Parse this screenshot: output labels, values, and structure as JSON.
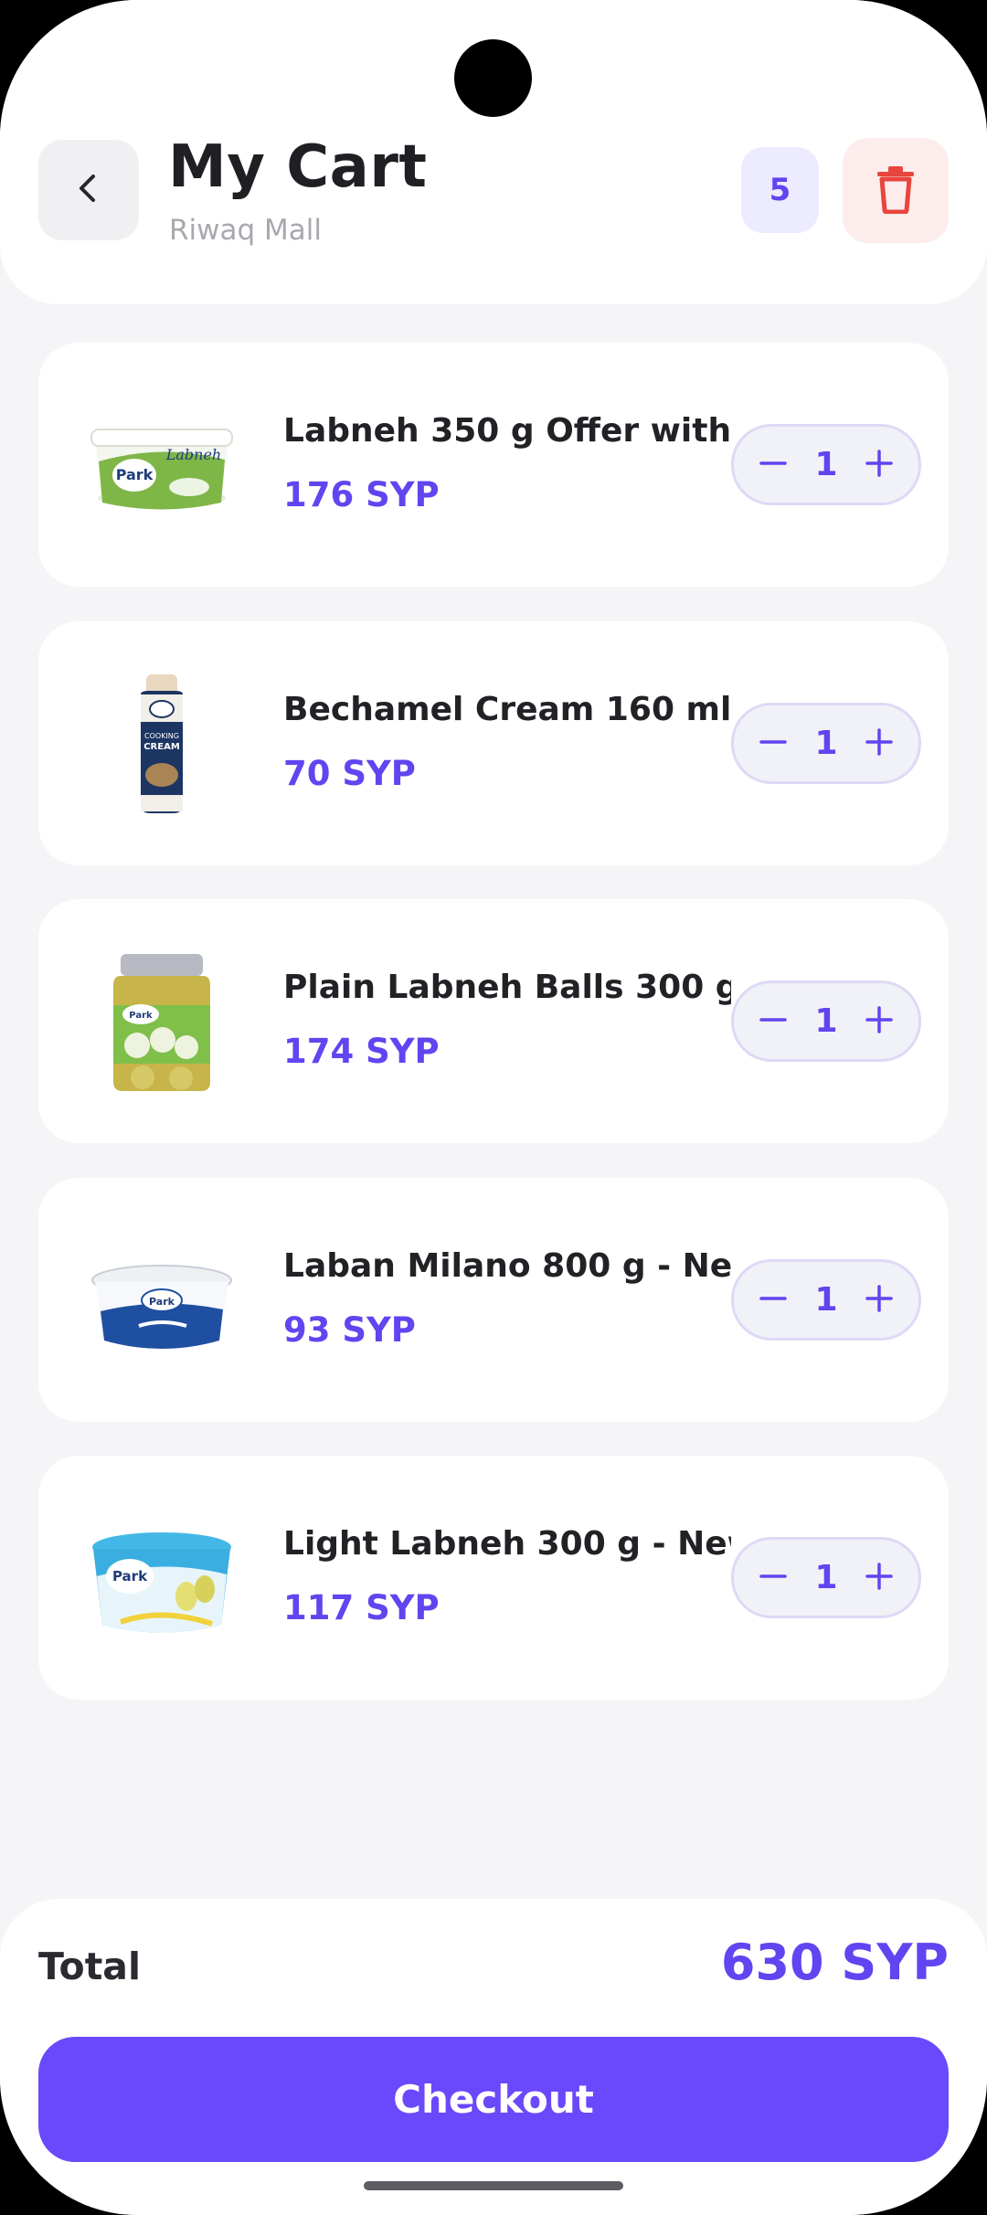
{
  "header": {
    "title": "My Cart",
    "subtitle": "Riwaq Mall",
    "item_count": "5"
  },
  "colors": {
    "accent": "#6a48fb",
    "price": "#6244f0",
    "danger": "#e8453c"
  },
  "cart": {
    "items": [
      {
        "name": "Labneh 350 g Offer with ...",
        "price": "176 SYP",
        "qty": "1",
        "image": "labneh-tub"
      },
      {
        "name": "Bechamel Cream 160 ml ...",
        "price": "70 SYP",
        "qty": "1",
        "image": "cooking-cream-bottle"
      },
      {
        "name": "Plain Labneh Balls 300 g ...",
        "price": "174 SYP",
        "qty": "1",
        "image": "labneh-balls-jar"
      },
      {
        "name": "Laban Milano 800 g - Ne...",
        "price": "93 SYP",
        "qty": "1",
        "image": "laban-tub"
      },
      {
        "name": "Light Labneh 300 g - New...",
        "price": "117 SYP",
        "qty": "1",
        "image": "light-labneh-tub"
      }
    ]
  },
  "footer": {
    "total_label": "Total",
    "total_value": "630 SYP",
    "checkout_label": "Checkout"
  }
}
